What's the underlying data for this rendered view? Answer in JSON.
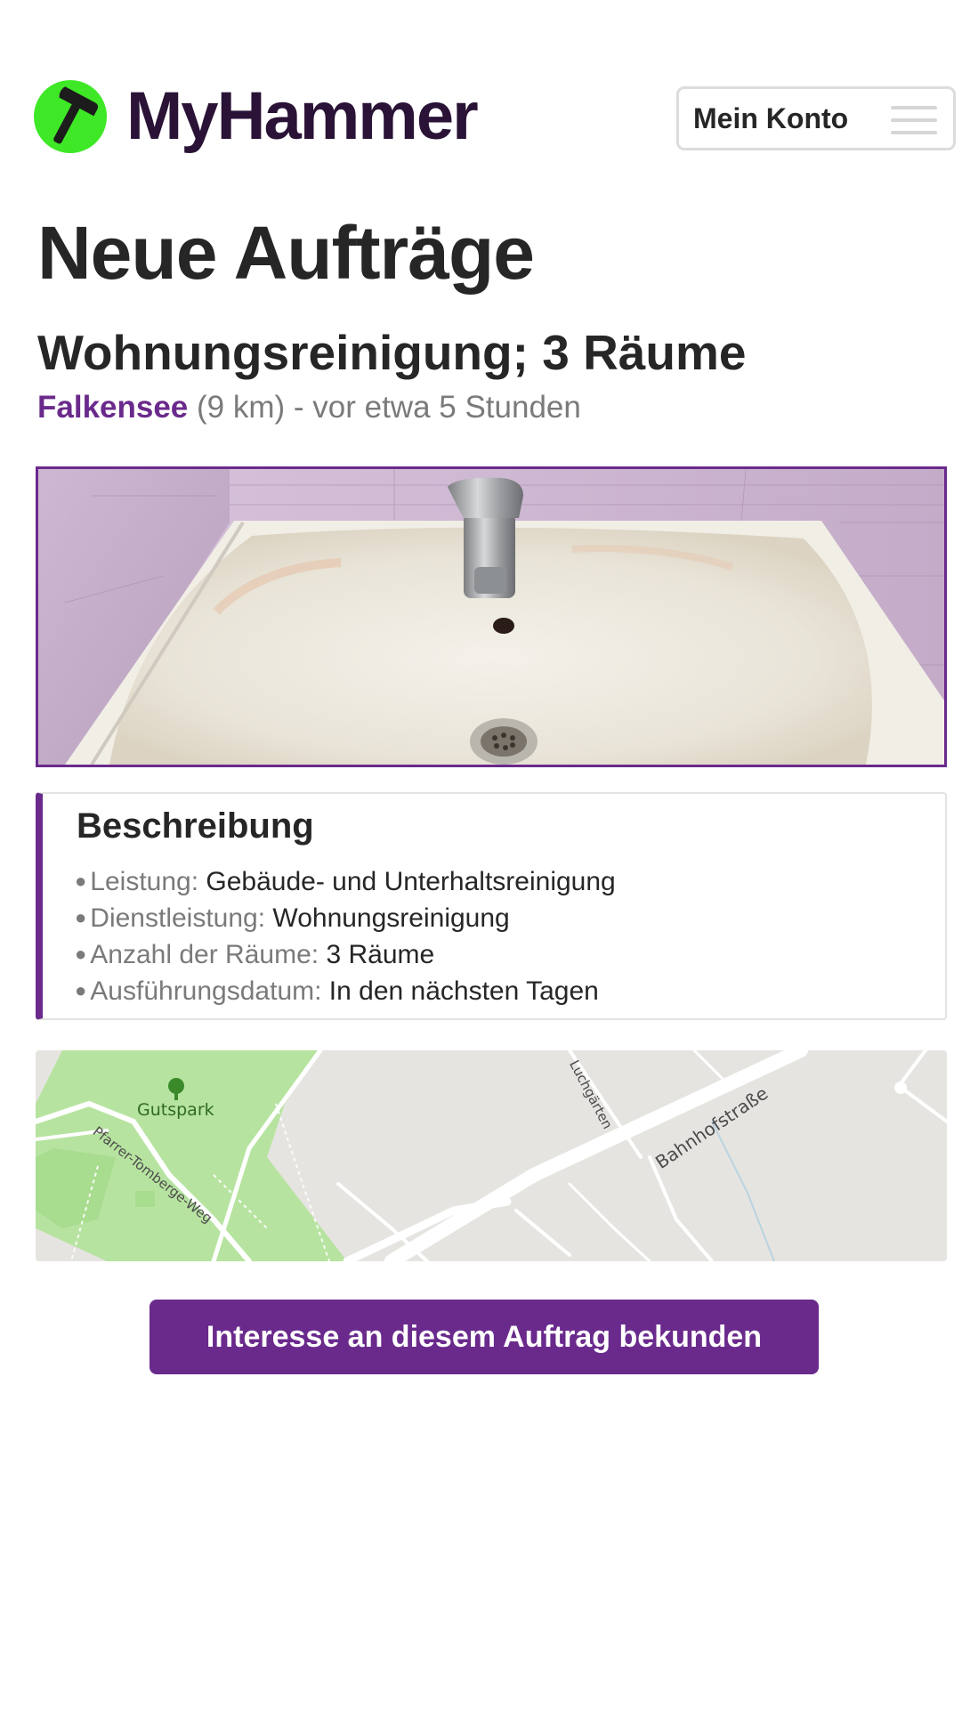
{
  "brand": {
    "name": "MyHammer",
    "accent_color": "#6a2a8c",
    "logo_color": "#3ee826"
  },
  "header": {
    "account_label": "Mein Konto",
    "menu_icon": "hamburger-icon"
  },
  "page": {
    "title": "Neue Aufträge"
  },
  "job": {
    "title": "Wohnungsreinigung; 3 Räume",
    "city": "Falkensee",
    "distance": "(9 km)",
    "time": " - vor etwa 5 Stunden"
  },
  "description": {
    "title": "Beschreibung",
    "items": [
      {
        "key": "Leistung:",
        "value": "Gebäude- und Unterhaltsreinigung"
      },
      {
        "key": "Dienstleistung:",
        "value": "Wohnungsreinigung"
      },
      {
        "key": "Anzahl der Räume:",
        "value": "3 Räume"
      },
      {
        "key": "Ausführungsdatum:",
        "value": "In den nächsten Tagen"
      }
    ]
  },
  "map": {
    "labels": [
      "Gutspark",
      "Pfarrer-Tomberge-Weg",
      "Luchgärten",
      "Bahnhofstraße"
    ]
  },
  "cta": {
    "label": "Interesse an diesem Auftrag bekunden"
  }
}
